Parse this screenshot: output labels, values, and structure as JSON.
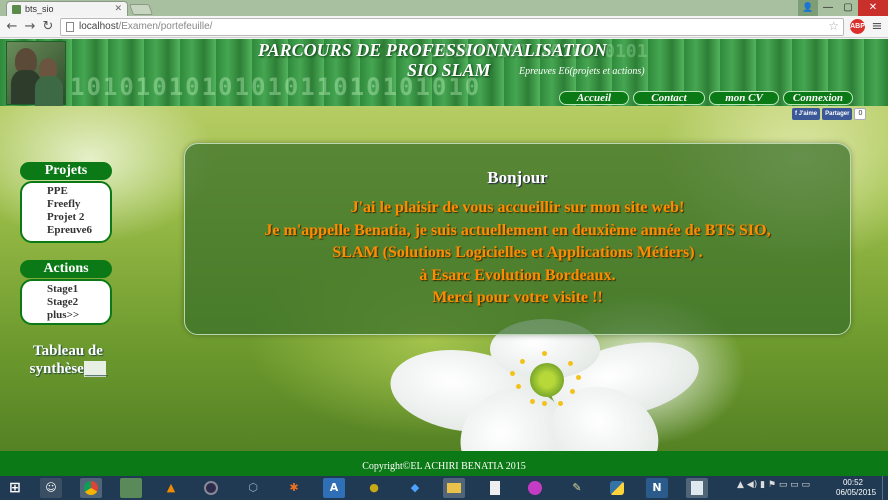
{
  "browser": {
    "tab_title": "bts_sio",
    "url_host": "localhost",
    "url_path": "/Examen/portefeuille/",
    "back": "←",
    "forward": "→",
    "reload": "↻",
    "user_glyph": "👤",
    "minimize": "—",
    "maximize": "▢",
    "close": "✕",
    "star": "☆",
    "menu": "≡",
    "ext_label": "ABP"
  },
  "header": {
    "title": "PARCOURS DE PROFESSIONNALISATION",
    "subtitle": "SIO SLAM",
    "tagline": "Epreuves E6(projets et actions)",
    "binary_row": "1010101010101011010101010",
    "binary_top": "0101010101 10101 0101"
  },
  "nav": {
    "items": [
      {
        "label": "Accueil"
      },
      {
        "label": "Contact"
      },
      {
        "label": "mon CV"
      },
      {
        "label": "Connexion"
      }
    ]
  },
  "social": {
    "like": "f J'aime",
    "share": "Partager",
    "count": "0"
  },
  "sidebar": {
    "projets": {
      "title": "Projets",
      "items": [
        "PPE",
        "Freefly",
        "Projet 2",
        "Epreuve6"
      ]
    },
    "actions": {
      "title": "Actions",
      "items": [
        "Stage1",
        "Stage2",
        "plus>>"
      ]
    },
    "synthese": {
      "line1": "Tableau de",
      "line2": "synthèse"
    }
  },
  "welcome": {
    "greeting": "Bonjour",
    "lines": [
      "J'ai le plaisir de vous accueillir sur mon site web!",
      "Je m'appelle Benatia, je suis actuellement en deuxième année de BTS SIO,",
      "SLAM (Solutions Logicielles et Applications Métiers) .",
      "à Esarc Evolution Bordeaux.",
      "Merci pour votre visite !!"
    ]
  },
  "footer": {
    "text": "Copyright©EL ACHIRI BENATIA 2015"
  },
  "taskbar": {
    "start": "⊞",
    "time": "00:52",
    "date": "06/05/2015",
    "tray": "▲ ◀) ▮ ⚑ ▭ ▭ ▭"
  }
}
